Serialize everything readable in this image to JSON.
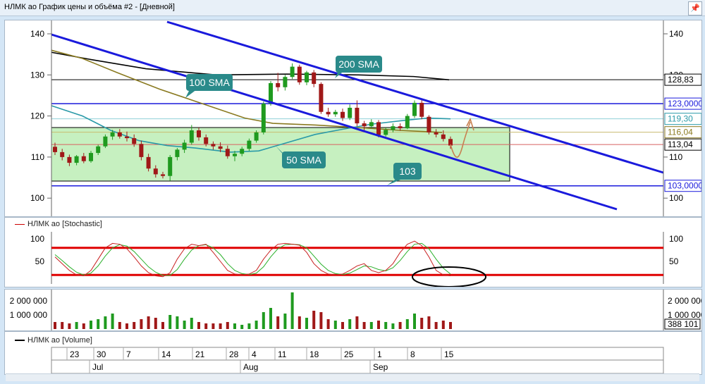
{
  "window": {
    "title": "НЛМК ао График цены и объёма #2 - [Дневной]",
    "pin_icon": "pin-icon"
  },
  "price_axis": {
    "ticks": [
      "140",
      "130",
      "120",
      "110",
      "100"
    ],
    "right_ticks": [
      "140",
      "130",
      "110",
      "100"
    ]
  },
  "price_tags": [
    {
      "label": "128,83",
      "value": 128.83,
      "color": "#000000"
    },
    {
      "label": "123,00000",
      "value": 123.0,
      "color": "#1a1adc"
    },
    {
      "label": "119,30",
      "value": 119.3,
      "color": "#2a9aa8"
    },
    {
      "label": "116,04",
      "value": 116.04,
      "color": "#8a7a20"
    },
    {
      "label": "113,04",
      "value": 113.04,
      "color": "#000000"
    },
    {
      "label": "103,00000",
      "value": 103.0,
      "color": "#1a1adc"
    }
  ],
  "callouts": {
    "sma200": "200 SMA",
    "sma100": "100 SMA",
    "sma50": "50 SMA",
    "level103": "103"
  },
  "stochastic": {
    "legend": "НЛМК ао [Stochastic]",
    "ticks": [
      "100",
      "50"
    ],
    "upper": 80,
    "lower": 20
  },
  "volume": {
    "legend": "НЛМК ао [Volume]",
    "ticks": [
      "2 000 000",
      "1 000 000"
    ],
    "right_ticks": [
      "2 000 000",
      "1 000 000"
    ],
    "last": "388 101"
  },
  "timeline": {
    "days": [
      "23",
      "30",
      "7",
      "14",
      "21",
      "28",
      "4",
      "11",
      "18",
      "25",
      "1",
      "8",
      "15"
    ],
    "months": [
      "Jul",
      "Aug",
      "Sep"
    ]
  },
  "colors": {
    "bull": "#1f9a1f",
    "bear": "#a01818",
    "channel": "#1a1adc",
    "zone": "#c6f0c0",
    "callout": "#2a8a8a"
  },
  "candles": [
    {
      "o": 112.5,
      "h": 113.5,
      "l": 110.5,
      "c": 111.2
    },
    {
      "o": 111.2,
      "h": 112.0,
      "l": 109.2,
      "c": 110.0
    },
    {
      "o": 110.0,
      "h": 110.6,
      "l": 107.8,
      "c": 108.6
    },
    {
      "o": 108.6,
      "h": 110.5,
      "l": 108.0,
      "c": 110.2
    },
    {
      "o": 110.2,
      "h": 111.0,
      "l": 108.5,
      "c": 109.0
    },
    {
      "o": 109.0,
      "h": 111.5,
      "l": 108.6,
      "c": 111.0
    },
    {
      "o": 111.0,
      "h": 113.0,
      "l": 110.5,
      "c": 112.6
    },
    {
      "o": 112.6,
      "h": 115.5,
      "l": 112.2,
      "c": 115.0
    },
    {
      "o": 115.0,
      "h": 116.6,
      "l": 114.2,
      "c": 116.0
    },
    {
      "o": 116.0,
      "h": 116.8,
      "l": 114.5,
      "c": 115.0
    },
    {
      "o": 115.0,
      "h": 116.2,
      "l": 113.8,
      "c": 114.6
    },
    {
      "o": 114.6,
      "h": 115.5,
      "l": 112.5,
      "c": 113.2
    },
    {
      "o": 113.2,
      "h": 114.0,
      "l": 109.2,
      "c": 110.0
    },
    {
      "o": 110.0,
      "h": 110.8,
      "l": 106.5,
      "c": 107.2
    },
    {
      "o": 107.2,
      "h": 108.0,
      "l": 105.0,
      "c": 105.8
    },
    {
      "o": 105.8,
      "h": 106.4,
      "l": 104.8,
      "c": 105.4
    },
    {
      "o": 105.4,
      "h": 110.5,
      "l": 104.2,
      "c": 110.0
    },
    {
      "o": 110.0,
      "h": 112.2,
      "l": 109.2,
      "c": 111.8
    },
    {
      "o": 111.8,
      "h": 114.2,
      "l": 111.0,
      "c": 113.5
    },
    {
      "o": 113.5,
      "h": 117.8,
      "l": 113.0,
      "c": 116.5
    },
    {
      "o": 116.5,
      "h": 117.2,
      "l": 114.0,
      "c": 114.8
    },
    {
      "o": 114.8,
      "h": 115.5,
      "l": 112.6,
      "c": 113.2
    },
    {
      "o": 113.2,
      "h": 113.8,
      "l": 111.8,
      "c": 112.6
    },
    {
      "o": 112.6,
      "h": 113.6,
      "l": 111.2,
      "c": 112.0
    },
    {
      "o": 112.0,
      "h": 112.8,
      "l": 109.6,
      "c": 110.2
    },
    {
      "o": 110.2,
      "h": 111.5,
      "l": 109.0,
      "c": 110.8
    },
    {
      "o": 110.8,
      "h": 112.5,
      "l": 110.2,
      "c": 112.0
    },
    {
      "o": 112.0,
      "h": 114.5,
      "l": 111.5,
      "c": 114.0
    },
    {
      "o": 114.0,
      "h": 116.5,
      "l": 113.5,
      "c": 116.0
    },
    {
      "o": 116.0,
      "h": 123.5,
      "l": 115.5,
      "c": 123.0
    },
    {
      "o": 123.0,
      "h": 128.5,
      "l": 122.5,
      "c": 128.0
    },
    {
      "o": 128.0,
      "h": 130.5,
      "l": 126.0,
      "c": 127.0
    },
    {
      "o": 127.0,
      "h": 130.0,
      "l": 126.2,
      "c": 129.5
    },
    {
      "o": 129.5,
      "h": 132.8,
      "l": 129.0,
      "c": 132.0
    },
    {
      "o": 132.0,
      "h": 132.5,
      "l": 127.6,
      "c": 128.2
    },
    {
      "o": 128.2,
      "h": 131.0,
      "l": 127.5,
      "c": 130.6
    },
    {
      "o": 130.6,
      "h": 131.2,
      "l": 127.0,
      "c": 127.8
    },
    {
      "o": 127.8,
      "h": 128.2,
      "l": 120.5,
      "c": 121.0
    },
    {
      "o": 121.0,
      "h": 122.0,
      "l": 119.8,
      "c": 120.4
    },
    {
      "o": 120.4,
      "h": 121.5,
      "l": 119.8,
      "c": 121.0
    },
    {
      "o": 121.0,
      "h": 121.8,
      "l": 118.8,
      "c": 119.5
    },
    {
      "o": 119.5,
      "h": 122.8,
      "l": 119.0,
      "c": 122.0
    },
    {
      "o": 122.0,
      "h": 123.8,
      "l": 117.5,
      "c": 118.2
    },
    {
      "o": 118.2,
      "h": 118.8,
      "l": 116.5,
      "c": 117.5
    },
    {
      "o": 117.5,
      "h": 119.2,
      "l": 117.0,
      "c": 118.5
    },
    {
      "o": 118.5,
      "h": 119.0,
      "l": 114.8,
      "c": 115.4
    },
    {
      "o": 115.4,
      "h": 117.2,
      "l": 115.0,
      "c": 116.6
    },
    {
      "o": 116.6,
      "h": 118.2,
      "l": 116.0,
      "c": 117.5
    },
    {
      "o": 117.5,
      "h": 118.2,
      "l": 116.4,
      "c": 117.0
    },
    {
      "o": 117.0,
      "h": 120.5,
      "l": 116.8,
      "c": 120.0
    },
    {
      "o": 120.0,
      "h": 123.8,
      "l": 119.5,
      "c": 123.2
    },
    {
      "o": 123.2,
      "h": 124.0,
      "l": 119.2,
      "c": 119.8
    },
    {
      "o": 119.8,
      "h": 120.2,
      "l": 115.5,
      "c": 116.0
    },
    {
      "o": 116.0,
      "h": 116.8,
      "l": 114.8,
      "c": 115.5
    },
    {
      "o": 115.5,
      "h": 116.5,
      "l": 113.8,
      "c": 114.4
    },
    {
      "o": 114.4,
      "h": 115.0,
      "l": 112.0,
      "c": 112.8
    }
  ],
  "volumes": [
    0.5,
    0.5,
    0.4,
    0.5,
    0.4,
    0.6,
    0.7,
    0.9,
    1.1,
    0.5,
    0.4,
    0.5,
    0.7,
    0.9,
    0.8,
    0.5,
    1.0,
    0.9,
    0.6,
    0.8,
    0.5,
    0.4,
    0.4,
    0.4,
    0.5,
    0.4,
    0.3,
    0.4,
    0.6,
    1.2,
    1.5,
    0.9,
    1.1,
    2.6,
    0.9,
    0.8,
    1.3,
    1.2,
    0.7,
    0.6,
    0.5,
    0.7,
    0.9,
    0.5,
    0.5,
    0.6,
    0.5,
    0.4,
    0.5,
    0.7,
    1.1,
    0.8,
    0.9,
    0.5,
    0.6,
    0.5
  ],
  "stoch_k": [
    60,
    45,
    30,
    20,
    18,
    30,
    55,
    80,
    90,
    88,
    78,
    60,
    40,
    25,
    18,
    16,
    25,
    55,
    78,
    88,
    85,
    88,
    70,
    50,
    30,
    22,
    20,
    22,
    30,
    55,
    75,
    88,
    90,
    88,
    86,
    70,
    45,
    30,
    22,
    20,
    22,
    30,
    40,
    45,
    30,
    25,
    30,
    45,
    70,
    88,
    95,
    85,
    60,
    30,
    20,
    18
  ],
  "stoch_d": [
    65,
    52,
    38,
    26,
    20,
    24,
    40,
    62,
    80,
    87,
    84,
    72,
    55,
    38,
    26,
    19,
    19,
    32,
    55,
    75,
    85,
    87,
    80,
    65,
    45,
    30,
    23,
    21,
    24,
    38,
    60,
    78,
    87,
    88,
    87,
    80,
    62,
    44,
    30,
    23,
    21,
    24,
    32,
    40,
    38,
    32,
    29,
    36,
    52,
    72,
    88,
    90,
    78,
    55,
    35,
    22
  ]
}
